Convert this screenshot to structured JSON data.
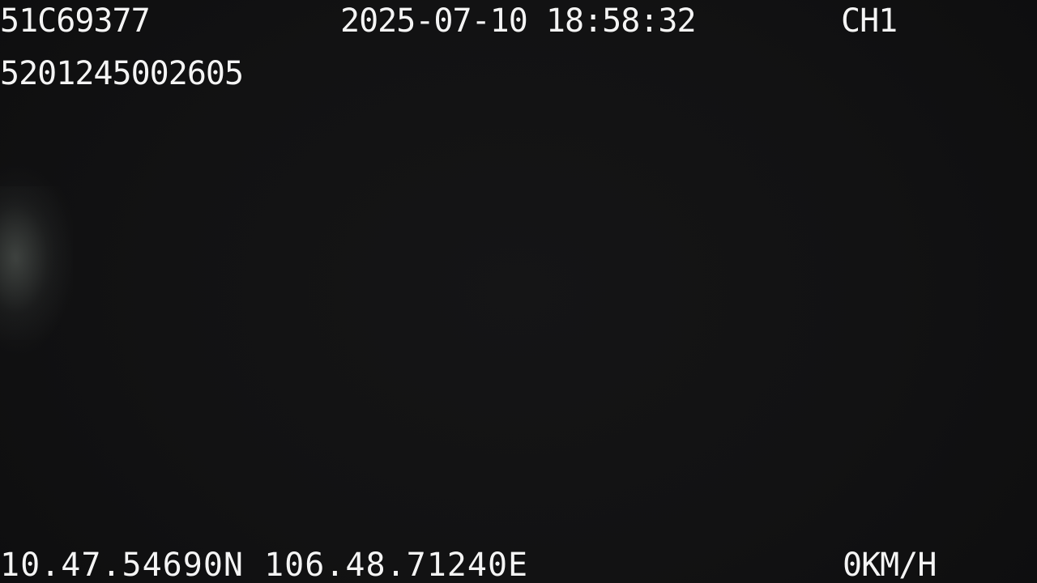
{
  "osd": {
    "plate": "51C69377",
    "datetime": "2025-07-10 18:58:32",
    "channel": "CH1",
    "device_id": "5201245002605",
    "gps": "10.47.54690N 106.48.71240E",
    "speed": "0KM/H"
  },
  "colors": {
    "background": "#121213",
    "text": "#f4f4f4"
  }
}
